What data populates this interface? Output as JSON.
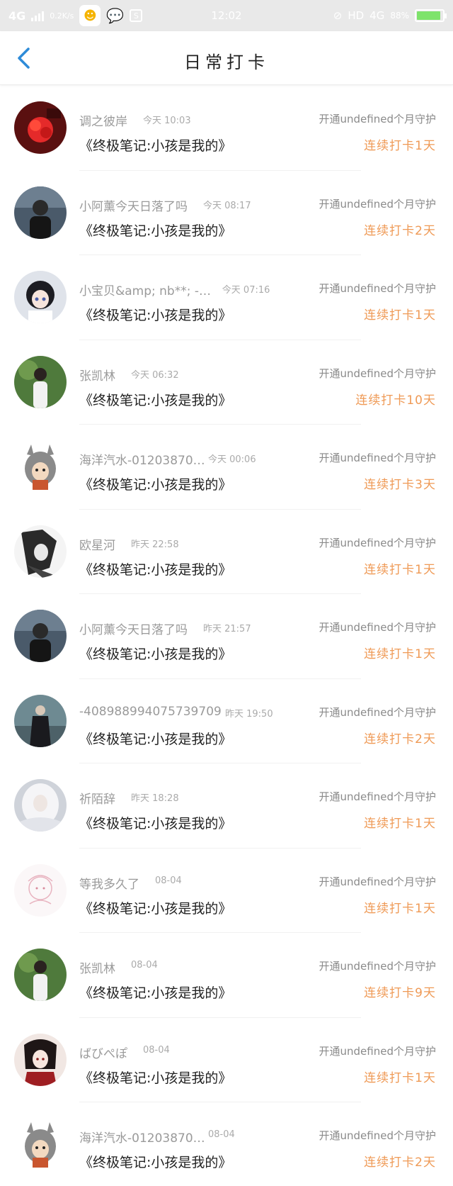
{
  "status_bar": {
    "network": "4G",
    "speed": "0.2K/s",
    "time": "12:02",
    "hd": "HD",
    "network_right": "4G",
    "battery": "88%"
  },
  "header": {
    "title": "日常打卡"
  },
  "colors": {
    "accent_blue": "#2e8bd8",
    "streak_orange": "#ef9a56",
    "battery_green": "#7ee36b"
  },
  "items": [
    {
      "name": "调之彼岸",
      "time": "今天 10:03",
      "note": "《终极笔记:小孩是我的》",
      "guard": "开通undefined个月守护",
      "streak": "连续打卡1天",
      "avatar": "red-flower"
    },
    {
      "name": "小阿薰今天日落了吗",
      "time": "今天 08:17",
      "note": "《终极笔记:小孩是我的》",
      "guard": "开通undefined个月守护",
      "streak": "连续打卡2天",
      "avatar": "person-dark"
    },
    {
      "name": "小宝贝&amp; nb**; -…",
      "time": "今天 07:16",
      "note": "《终极笔记:小孩是我的》",
      "guard": "开通undefined个月守护",
      "streak": "连续打卡1天",
      "avatar": "anime-girl"
    },
    {
      "name": "张凯林",
      "time": "今天 06:32",
      "note": "《终极笔记:小孩是我的》",
      "guard": "开通undefined个月守护",
      "streak": "连续打卡10天",
      "avatar": "person-green"
    },
    {
      "name": "海洋汽水-01203870…",
      "time": "今天 00:06",
      "note": "《终极笔记:小孩是我的》",
      "guard": "开通undefined个月守护",
      "streak": "连续打卡3天",
      "avatar": "totoro"
    },
    {
      "name": "欧星河",
      "time": "昨天 22:58",
      "note": "《终极笔记:小孩是我的》",
      "guard": "开通undefined个月守护",
      "streak": "连续打卡1天",
      "avatar": "anime-bw"
    },
    {
      "name": "小阿薰今天日落了吗",
      "time": "昨天 21:57",
      "note": "《终极笔记:小孩是我的》",
      "guard": "开通undefined个月守护",
      "streak": "连续打卡1天",
      "avatar": "person-dark"
    },
    {
      "name": "-4089889940757397098",
      "time": "昨天 19:50",
      "note": "《终极笔记:小孩是我的》",
      "guard": "开通undefined个月守护",
      "streak": "连续打卡2天",
      "avatar": "warrior"
    },
    {
      "name": "祈陌辞",
      "time": "昨天 18:28",
      "note": "《终极笔记:小孩是我的》",
      "guard": "开通undefined个月守护",
      "streak": "连续打卡1天",
      "avatar": "white-hair"
    },
    {
      "name": "等我多久了",
      "time": "08-04",
      "note": "《终极笔记:小孩是我的》",
      "guard": "开通undefined个月守护",
      "streak": "连续打卡1天",
      "avatar": "sketch"
    },
    {
      "name": "张凯林",
      "time": "08-04",
      "note": "《终极笔记:小孩是我的》",
      "guard": "开通undefined个月守护",
      "streak": "连续打卡9天",
      "avatar": "person-green"
    },
    {
      "name": "ばびぺぽ",
      "time": "08-04",
      "note": "《终极笔记:小孩是我的》",
      "guard": "开通undefined个月守护",
      "streak": "连续打卡1天",
      "avatar": "anime-red"
    },
    {
      "name": "海洋汽水-01203870…",
      "time": "08-04",
      "note": "《终极笔记:小孩是我的》",
      "guard": "开通undefined个月守护",
      "streak": "连续打卡2天",
      "avatar": "totoro"
    }
  ]
}
